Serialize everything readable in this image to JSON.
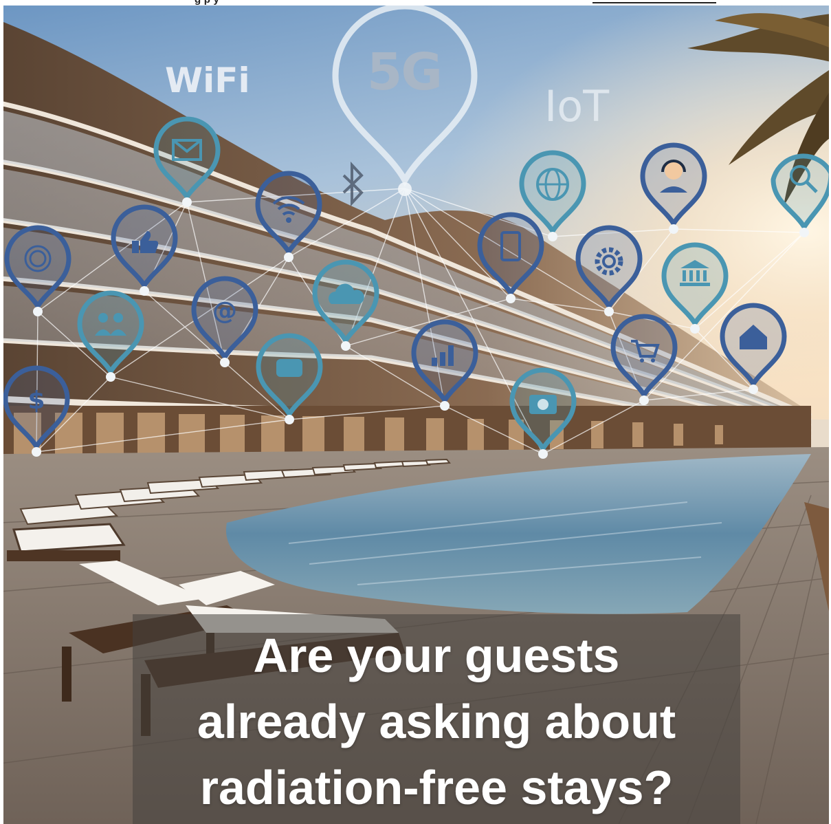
{
  "image": {
    "labels": {
      "five_g": "5G",
      "wifi": "WiFi",
      "iot": "IoT"
    },
    "headline_lines": [
      "Are your guests",
      "already asking about",
      "radiation-free stays?"
    ],
    "top_cut_text": "g                                                                                    p      y"
  },
  "colors": {
    "pin_dark": "#3b5f9a",
    "pin_teal": "#4a96b2",
    "pin_light": "#e8eef4",
    "headline": "#ffffff"
  },
  "icons": [
    "envelope-icon",
    "fingerprint-icon",
    "thumbs-up-icon",
    "wifi-icon",
    "globe-icon",
    "headset-icon",
    "search-icon",
    "tablet-icon",
    "gear-icon",
    "bank-icon",
    "people-icon",
    "at-sign-icon",
    "cloud-icon",
    "chat-icon",
    "bar-chart-icon",
    "shopping-cart-icon",
    "home-icon",
    "dollar-icon",
    "camera-icon",
    "bluetooth-icon"
  ]
}
